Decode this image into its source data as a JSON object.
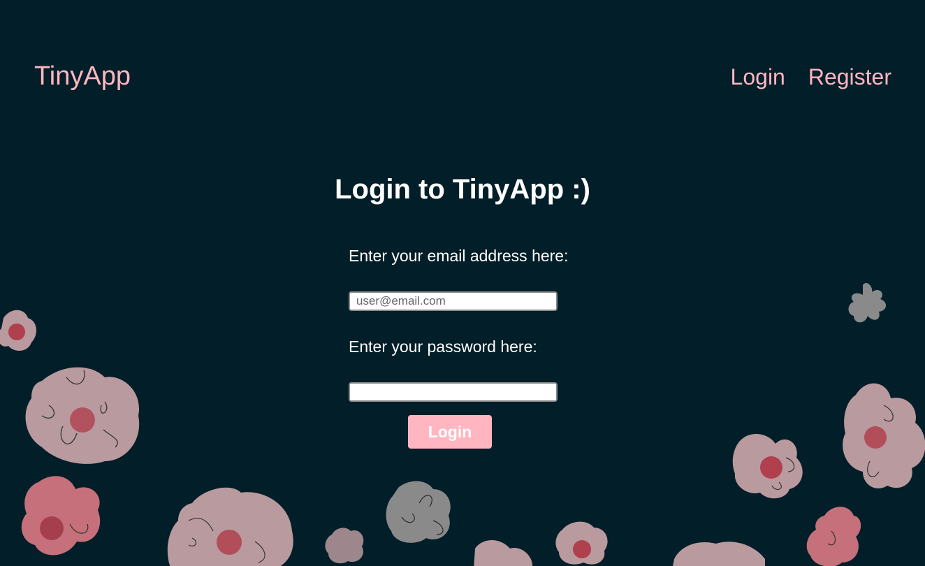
{
  "header": {
    "brand": "TinyApp",
    "nav": {
      "login_label": "Login",
      "register_label": "Register"
    }
  },
  "main": {
    "title": "Login to TinyApp :)",
    "email": {
      "label": "Enter your email address here:",
      "placeholder": "user@email.com",
      "value": ""
    },
    "password": {
      "label": "Enter your password here:",
      "value": ""
    },
    "submit_label": "Login"
  },
  "theme": {
    "background": "#021e28",
    "accent": "#ffb6c1",
    "text": "#ffffff",
    "flower_pink": "#b99a9e",
    "flower_rose": "#c5707a",
    "flower_grey": "#8a8a8a",
    "flower_center": "#b0404e"
  }
}
